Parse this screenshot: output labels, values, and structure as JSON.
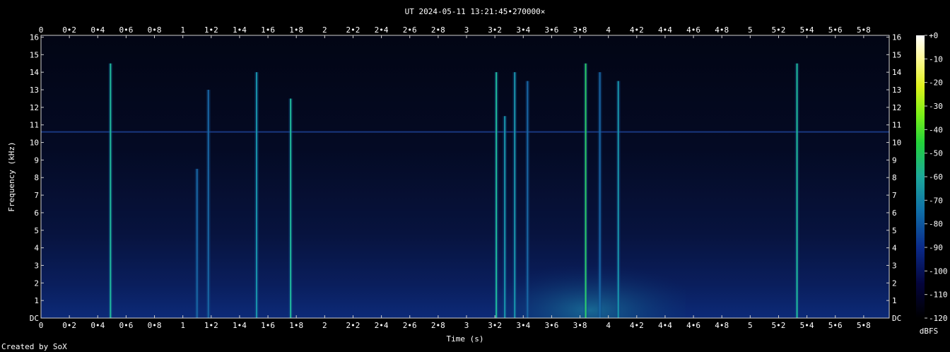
{
  "chart_data": {
    "type": "heatmap",
    "title": "UT 2024-05-11 13:21:45•270000×",
    "xlabel": "Time (s)",
    "ylabel": "Frequency (kHz)",
    "xlim": [
      0,
      5.98
    ],
    "ylim": [
      0,
      16.1
    ],
    "x_ticks": [
      "0",
      "0•2",
      "0•4",
      "0•6",
      "0•8",
      "1",
      "1•2",
      "1•4",
      "1•6",
      "1•8",
      "2",
      "2•2",
      "2•4",
      "2•6",
      "2•8",
      "3",
      "3•2",
      "3•4",
      "3•6",
      "3•8",
      "4",
      "4•2",
      "4•4",
      "4•6",
      "4•8",
      "5",
      "5•2",
      "5•4",
      "5•6",
      "5•8"
    ],
    "y_ticks": [
      "DC",
      "1",
      "2",
      "3",
      "4",
      "5",
      "6",
      "7",
      "8",
      "9",
      "10",
      "11",
      "12",
      "13",
      "14",
      "15",
      "16"
    ],
    "colorbar": {
      "label": "dBFS",
      "ticks": [
        "+0",
        "-10",
        "-20",
        "-30",
        "-40",
        "-50",
        "-60",
        "-70",
        "-80",
        "-90",
        "-100",
        "-110",
        "-120"
      ],
      "range": [
        -120,
        0
      ]
    },
    "hum_line_khz": 10.6,
    "events": [
      {
        "t": 0.49,
        "f_top": 14.5,
        "level_db": -60
      },
      {
        "t": 1.1,
        "f_top": 8.5,
        "level_db": -75
      },
      {
        "t": 1.18,
        "f_top": 13.0,
        "level_db": -75
      },
      {
        "t": 1.52,
        "f_top": 14.0,
        "level_db": -70
      },
      {
        "t": 1.76,
        "f_top": 12.5,
        "level_db": -60
      },
      {
        "t": 3.21,
        "f_top": 14.0,
        "level_db": -62
      },
      {
        "t": 3.27,
        "f_top": 11.5,
        "level_db": -70
      },
      {
        "t": 3.34,
        "f_top": 14.0,
        "level_db": -68
      },
      {
        "t": 3.43,
        "f_top": 13.5,
        "level_db": -75
      },
      {
        "t": 3.84,
        "f_top": 14.5,
        "level_db": -52
      },
      {
        "t": 3.94,
        "f_top": 14.0,
        "level_db": -75
      },
      {
        "t": 4.07,
        "f_top": 13.5,
        "level_db": -72
      },
      {
        "t": 5.33,
        "f_top": 14.5,
        "level_db": -58
      }
    ]
  },
  "footer": {
    "credit": "Created by SoX"
  }
}
